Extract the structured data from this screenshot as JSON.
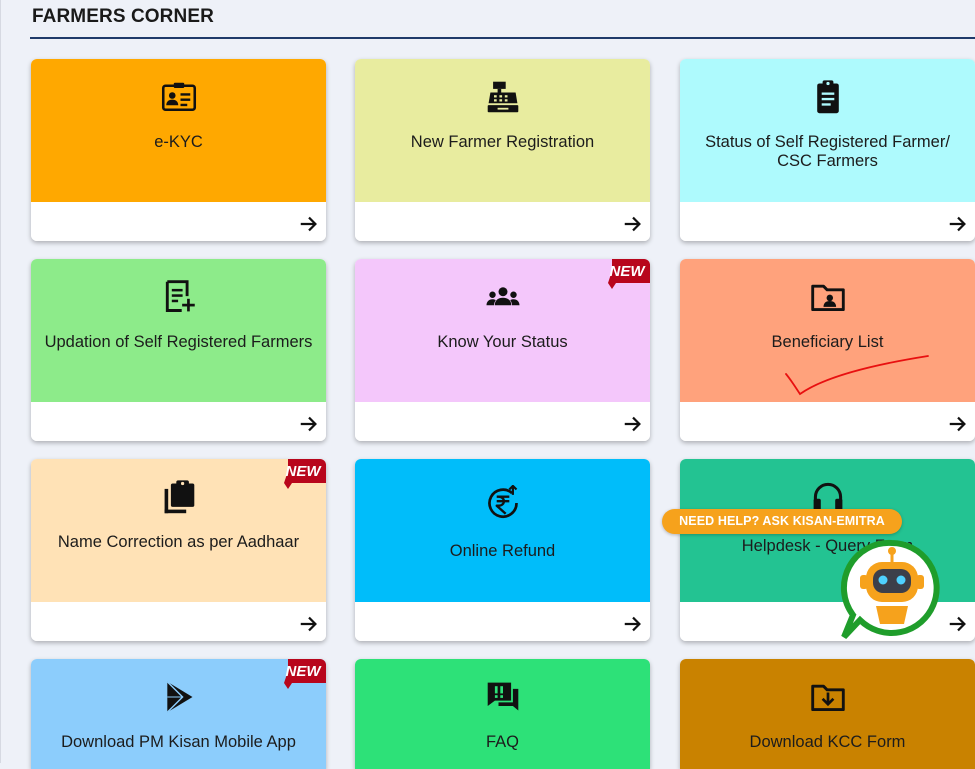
{
  "section": {
    "title": "FARMERS CORNER"
  },
  "cards": [
    {
      "label": "e-KYC",
      "icon": "id-card-icon",
      "color": "#ffa800",
      "new": false
    },
    {
      "label": "New Farmer Registration",
      "icon": "cash-register-icon",
      "color": "#e8ec9f",
      "new": false
    },
    {
      "label": "Status of Self Registered Farmer/ CSC Farmers",
      "icon": "clipboard-list-icon",
      "color": "#aefafd",
      "new": false
    },
    {
      "label": "Updation of Self Registered Farmers",
      "icon": "note-add-icon",
      "color": "#8deb8a",
      "new": false
    },
    {
      "label": "Know Your Status",
      "icon": "people-group-icon",
      "color": "#f4c7fb",
      "new": true
    },
    {
      "label": "Beneficiary List",
      "icon": "folder-user-icon",
      "color": "#ffa27c",
      "new": false
    },
    {
      "label": "Name Correction as per Aadhaar",
      "icon": "clipboard-copy-icon",
      "color": "#ffe2b6",
      "new": true
    },
    {
      "label": "Online Refund",
      "icon": "rupee-refund-icon",
      "color": "#00bdfa",
      "new": false
    },
    {
      "label": "Helpdesk - Query Form",
      "icon": "headset-icon",
      "color": "#23c392",
      "new": false
    },
    {
      "label": "Download PM Kisan Mobile App",
      "icon": "play-store-icon",
      "color": "#8ccdfc",
      "new": true
    },
    {
      "label": "FAQ",
      "icon": "faq-chat-icon",
      "color": "#2de178",
      "new": false
    },
    {
      "label": "Download KCC Form",
      "icon": "folder-download-icon",
      "color": "#c98200",
      "new": false
    }
  ],
  "badge": {
    "new_label": "NEW",
    "color": "#b8061c"
  },
  "help": {
    "label": "NEED HELP? ASK KISAN-EMITRA",
    "color": "#f6a21c"
  },
  "bot": {
    "icon": "chatbot-icon",
    "ring_color": "#1f9d2b",
    "face_color": "#f6a21c"
  }
}
